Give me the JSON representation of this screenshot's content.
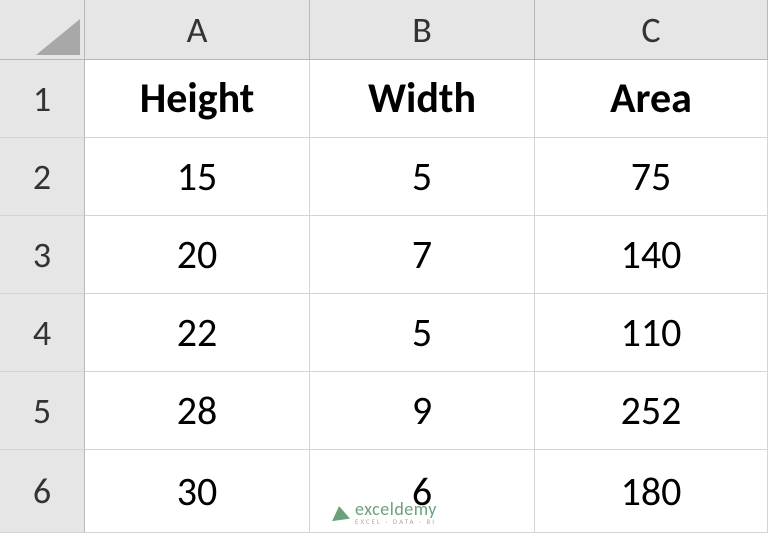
{
  "columns": {
    "A": "A",
    "B": "B",
    "C": "C"
  },
  "rownums": {
    "r1": "1",
    "r2": "2",
    "r3": "3",
    "r4": "4",
    "r5": "5",
    "r6": "6"
  },
  "headers": {
    "A": "Height",
    "B": "Width",
    "C": "Area"
  },
  "rows": [
    {
      "A": "15",
      "B": "5",
      "C": "75"
    },
    {
      "A": "20",
      "B": "7",
      "C": "140"
    },
    {
      "A": "22",
      "B": "5",
      "C": "110"
    },
    {
      "A": "28",
      "B": "9",
      "C": "252"
    },
    {
      "A": "30",
      "B": "6",
      "C": "180"
    }
  ],
  "watermark": {
    "main": "exceldemy",
    "sub": "EXCEL · DATA · BI"
  }
}
